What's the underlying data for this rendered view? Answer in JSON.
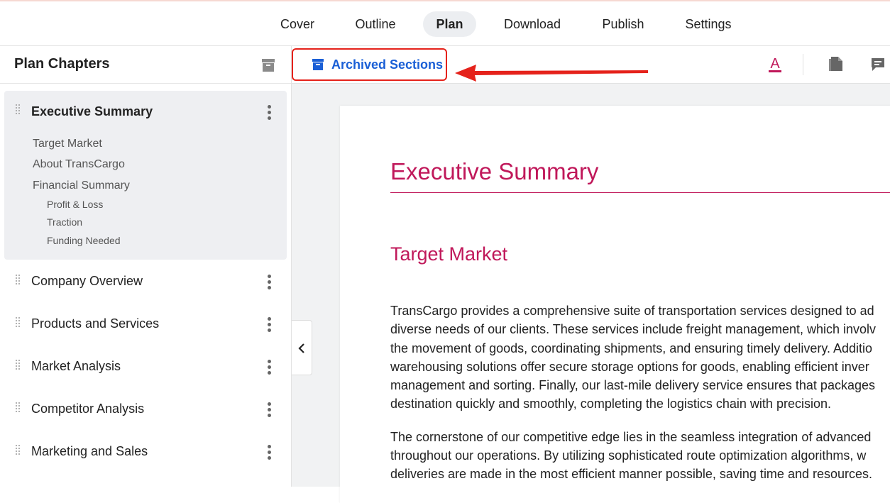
{
  "nav": {
    "tabs": [
      {
        "label": "Cover",
        "active": false
      },
      {
        "label": "Outline",
        "active": false
      },
      {
        "label": "Plan",
        "active": true
      },
      {
        "label": "Download",
        "active": false
      },
      {
        "label": "Publish",
        "active": false
      },
      {
        "label": "Settings",
        "active": false
      }
    ]
  },
  "sidebar": {
    "title": "Plan Chapters",
    "archive_icon": "archive-box-icon",
    "active_chapter": {
      "label": "Executive Summary",
      "sections": [
        {
          "label": "Target Market"
        },
        {
          "label": "About TransCargo"
        },
        {
          "label": "Financial Summary",
          "subsections": [
            "Profit & Loss",
            "Traction",
            "Funding Needed"
          ]
        }
      ]
    },
    "chapters": [
      {
        "label": "Company Overview"
      },
      {
        "label": "Products and Services"
      },
      {
        "label": "Market Analysis"
      },
      {
        "label": "Competitor Analysis"
      },
      {
        "label": "Marketing and Sales"
      }
    ]
  },
  "toolbar": {
    "archived_label": "Archived Sections",
    "icons": [
      "archive-icon",
      "text-color-icon",
      "document-icon",
      "comment-icon"
    ],
    "accent_color": "#1a5fd6",
    "highlight_color": "#e5221b"
  },
  "document": {
    "title": "Executive Summary",
    "section_heading": "Target Market",
    "heading_color": "#c0185a",
    "paragraph1": [
      "TransCargo provides a comprehensive suite of transportation services designed to ad",
      "diverse needs of our clients. These services include freight management, which involv",
      "the movement of goods, coordinating shipments, and ensuring timely delivery. Additio",
      "warehousing solutions offer secure storage options for goods, enabling efficient inver",
      "management and sorting. Finally, our last-mile delivery service ensures that packages",
      "destination quickly and smoothly, completing the logistics chain with precision."
    ],
    "paragraph2": [
      "The cornerstone of our competitive edge lies in the seamless integration of advanced",
      "throughout our operations. By utilizing sophisticated route optimization algorithms, w",
      "deliveries are made in the most efficient manner possible, saving time and resources."
    ]
  }
}
